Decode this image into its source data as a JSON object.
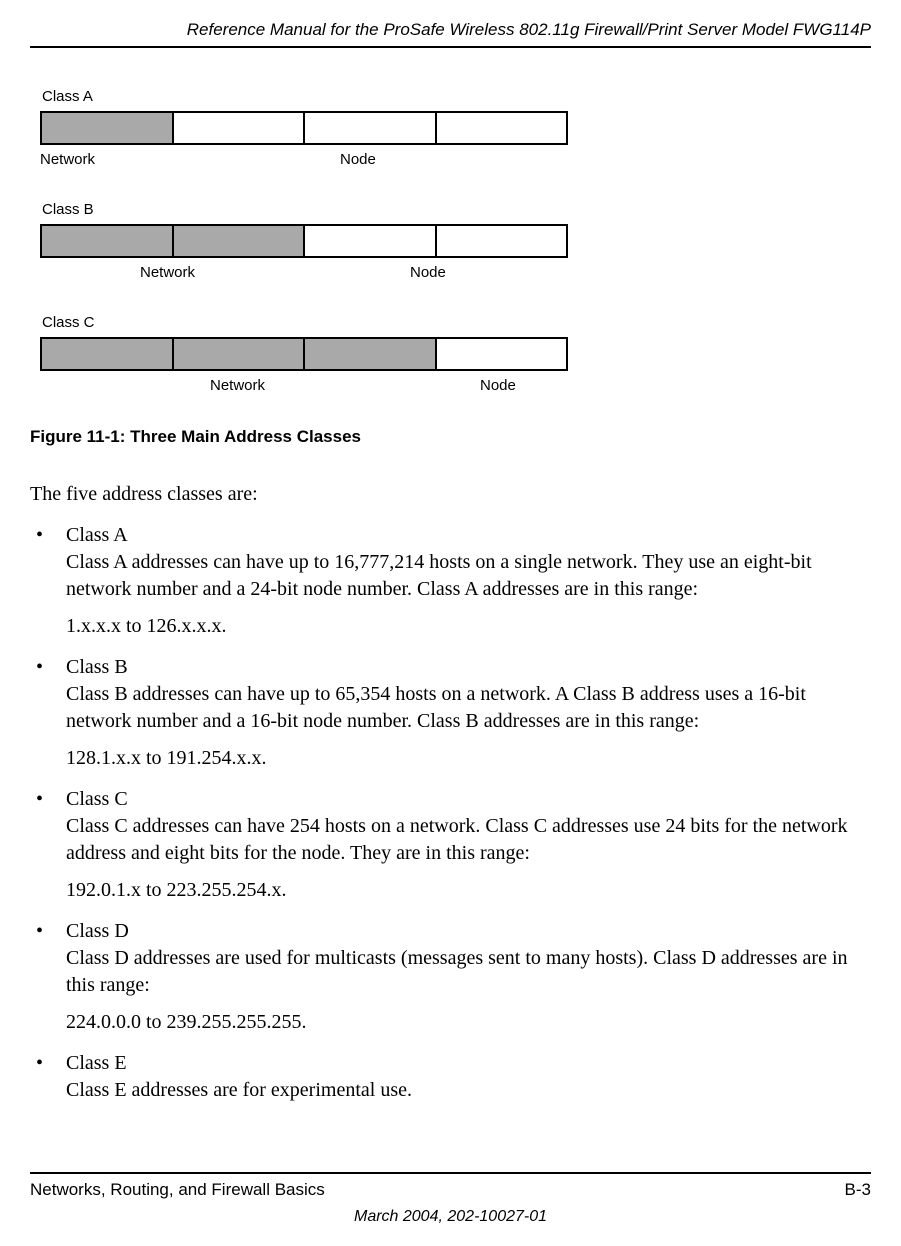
{
  "header": {
    "title": "Reference Manual for the ProSafe Wireless 802.11g  Firewall/Print Server Model FWG114P"
  },
  "chart_data": [
    {
      "type": "table",
      "title": "Class A",
      "octets": [
        "network",
        "node",
        "node",
        "node"
      ],
      "labels": {
        "network": "Network",
        "node": "Node"
      },
      "network_bits": 8,
      "node_bits": 24
    },
    {
      "type": "table",
      "title": "Class B",
      "octets": [
        "network",
        "network",
        "node",
        "node"
      ],
      "labels": {
        "network": "Network",
        "node": "Node"
      },
      "network_bits": 16,
      "node_bits": 16
    },
    {
      "type": "table",
      "title": "Class C",
      "octets": [
        "network",
        "network",
        "network",
        "node"
      ],
      "labels": {
        "network": "Network",
        "node": "Node"
      },
      "network_bits": 24,
      "node_bits": 8
    }
  ],
  "diagram": {
    "classA": {
      "label": "Class A",
      "network": "Network",
      "node": "Node"
    },
    "classB": {
      "label": "Class B",
      "network": "Network",
      "node": "Node"
    },
    "classC": {
      "label": "Class C",
      "network": "Network",
      "node": "Node"
    }
  },
  "figure": {
    "caption": "Figure 11-1:  Three Main Address Classes"
  },
  "body": {
    "intro": "The five address classes are:",
    "bullet": "•",
    "items": [
      {
        "title": "Class A",
        "desc": "Class A addresses can have up to 16,777,214 hosts on a single network. They use an eight-bit network number and a 24-bit node number. Class A addresses are in this range:",
        "range": "1.x.x.x to 126.x.x.x."
      },
      {
        "title": "Class B",
        "desc": "Class B addresses can have up to 65,354 hosts on a network. A Class B address uses a 16-bit network number and a 16-bit node number. Class B addresses are in this range:",
        "range": "128.1.x.x to 191.254.x.x."
      },
      {
        "title": "Class C",
        "desc": "Class C addresses can have 254 hosts on a network. Class C addresses use 24 bits for the network address and eight bits for the node. They are in this range:",
        "range": "192.0.1.x to 223.255.254.x."
      },
      {
        "title": "Class D",
        "desc": "Class D addresses are used for multicasts (messages sent to many hosts). Class D addresses are in this range:",
        "range": "224.0.0.0 to 239.255.255.255."
      },
      {
        "title": "Class E",
        "desc": "Class E addresses are for experimental use.",
        "range": ""
      }
    ]
  },
  "footer": {
    "left": "Networks, Routing, and Firewall Basics",
    "right": "B-3",
    "center": "March 2004, 202-10027-01"
  }
}
